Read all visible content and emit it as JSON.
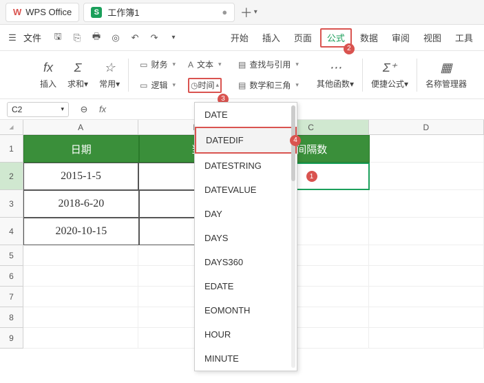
{
  "titlebar": {
    "app_name": "WPS Office",
    "doc_name": "工作簿1"
  },
  "file_menu": "文件",
  "menu_tabs": {
    "start": "开始",
    "insert": "插入",
    "layout": "页面",
    "formula": "公式",
    "data": "数据",
    "review": "审阅",
    "view": "视图",
    "tools": "工具"
  },
  "callouts": {
    "c1": "1",
    "c2": "2",
    "c3": "3",
    "c4": "4"
  },
  "toolbar": {
    "insert": "插入",
    "sum": "求和",
    "common": "常用",
    "finance": "财务",
    "text": "文本",
    "lookup": "查找与引用",
    "logic": "逻辑",
    "time": "时间",
    "math": "数学和三角",
    "more": "其他函数",
    "quick": "便捷公式",
    "names": "名称管理器"
  },
  "namebox": "C2",
  "columns": [
    "A",
    "B",
    "C",
    "D"
  ],
  "header_cells": {
    "a": "日期",
    "b": "当",
    "c": "间隔数"
  },
  "data_rows": [
    {
      "a": "2015-1-5",
      "b": "20"
    },
    {
      "a": "2018-6-20",
      "b": "202"
    },
    {
      "a": "2020-10-15",
      "b": "202"
    }
  ],
  "row_numbers": [
    "1",
    "2",
    "3",
    "4",
    "5",
    "6",
    "7",
    "8",
    "9"
  ],
  "dropdown": {
    "items": [
      "DATE",
      "DATEDIF",
      "DATESTRING",
      "DATEVALUE",
      "DAY",
      "DAYS",
      "DAYS360",
      "EDATE",
      "EOMONTH",
      "HOUR",
      "MINUTE"
    ]
  }
}
